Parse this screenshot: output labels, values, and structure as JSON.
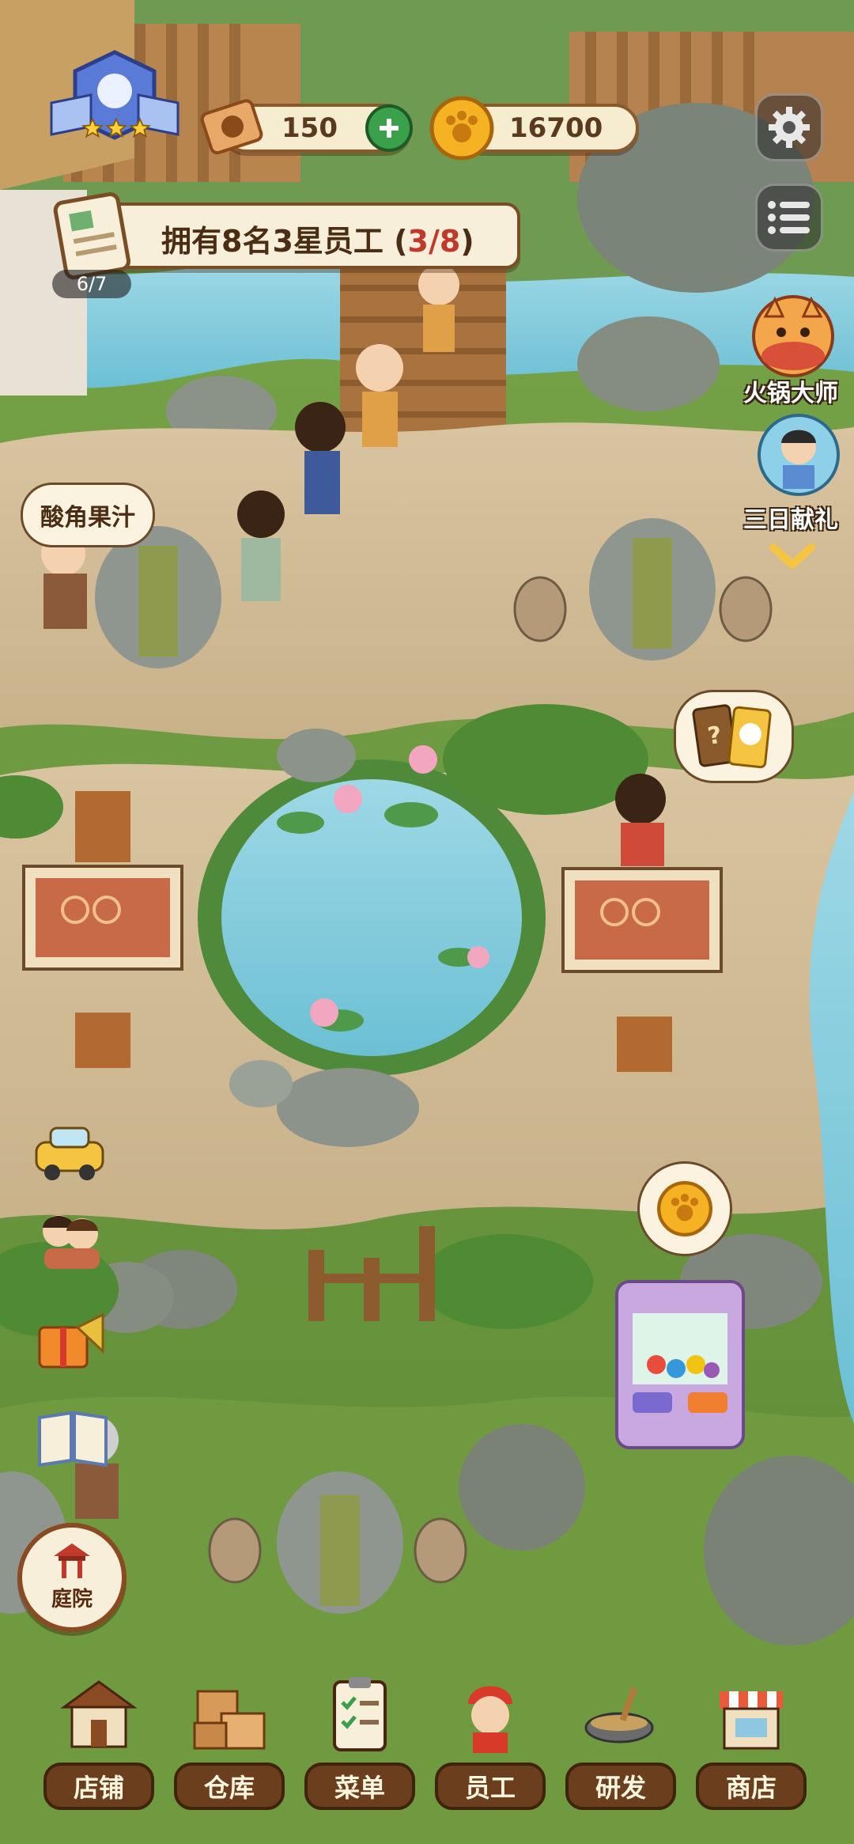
{
  "hud": {
    "tickets": "150",
    "coins": "16700",
    "stars": 3
  },
  "quest": {
    "text": "拥有8名3星员工",
    "open_paren": "(",
    "progress": "3/8",
    "close_paren": ")",
    "task_count": "6/7"
  },
  "side_events": [
    {
      "label": "火锅大师",
      "icon": "hotpot-cat-icon"
    },
    {
      "label": "三日献礼",
      "icon": "gift-character-icon"
    }
  ],
  "customer_order": "酸角果汁",
  "location_button": "庭院",
  "bottom_nav": [
    {
      "label": "店铺",
      "icon": "shop-building-icon"
    },
    {
      "label": "仓库",
      "icon": "warehouse-boxes-icon"
    },
    {
      "label": "菜单",
      "icon": "menu-clipboard-icon"
    },
    {
      "label": "员工",
      "icon": "staff-chef-icon"
    },
    {
      "label": "研发",
      "icon": "research-wok-icon"
    },
    {
      "label": "商店",
      "icon": "store-stall-icon"
    }
  ],
  "colors": {
    "pill_border": "#8a5a2b",
    "nav_label": "#6b3e1d",
    "add_button": "#3aa14a",
    "progress_highlight": "#c0392b"
  }
}
